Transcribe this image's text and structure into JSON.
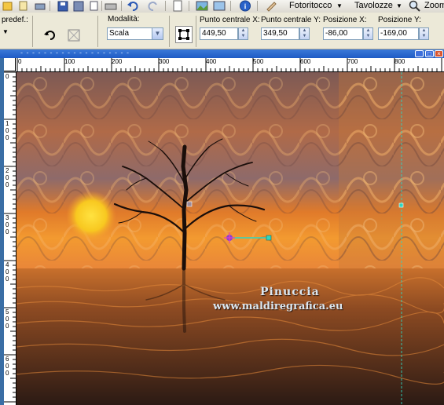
{
  "toolbar": {
    "menus": [
      {
        "label": "Fotoritocco"
      },
      {
        "label": "Tavolozze"
      },
      {
        "label": "Zoom"
      }
    ]
  },
  "options": {
    "preset_label": "predef.:",
    "mode_label": "Modalità:",
    "mode_value": "Scala",
    "center_x_label": "Punto centrale X:",
    "center_x_value": "449,50",
    "center_y_label": "Punto centrale Y:",
    "center_y_value": "349,50",
    "pos_x_label": "Posizione X:",
    "pos_x_value": "-86,00",
    "pos_y_label": "Posizione Y:",
    "pos_y_value": "-169,00"
  },
  "rulers": {
    "h_ticks": [
      "0",
      "100",
      "200",
      "300",
      "400",
      "500",
      "600",
      "700",
      "800"
    ],
    "v_ticks": [
      {
        "digits": [
          "0"
        ]
      },
      {
        "digits": [
          "1",
          "0",
          "0"
        ]
      },
      {
        "digits": [
          "2",
          "0",
          "0"
        ]
      },
      {
        "digits": [
          "3",
          "0",
          "0"
        ]
      },
      {
        "digits": [
          "4",
          "0",
          "0"
        ]
      },
      {
        "digits": [
          "5",
          "0",
          "0"
        ]
      },
      {
        "digits": [
          "6",
          "0",
          "0"
        ]
      }
    ]
  },
  "canvas": {
    "watermark_line1": "Pinuccia",
    "watermark_line2": "www.maldiregrafica.eu"
  },
  "colors": {
    "accent": "#3b79d8",
    "sky_top": "#7e5f5a",
    "sun": "#f8c820",
    "deformation_handle": "#2fd6c0"
  }
}
